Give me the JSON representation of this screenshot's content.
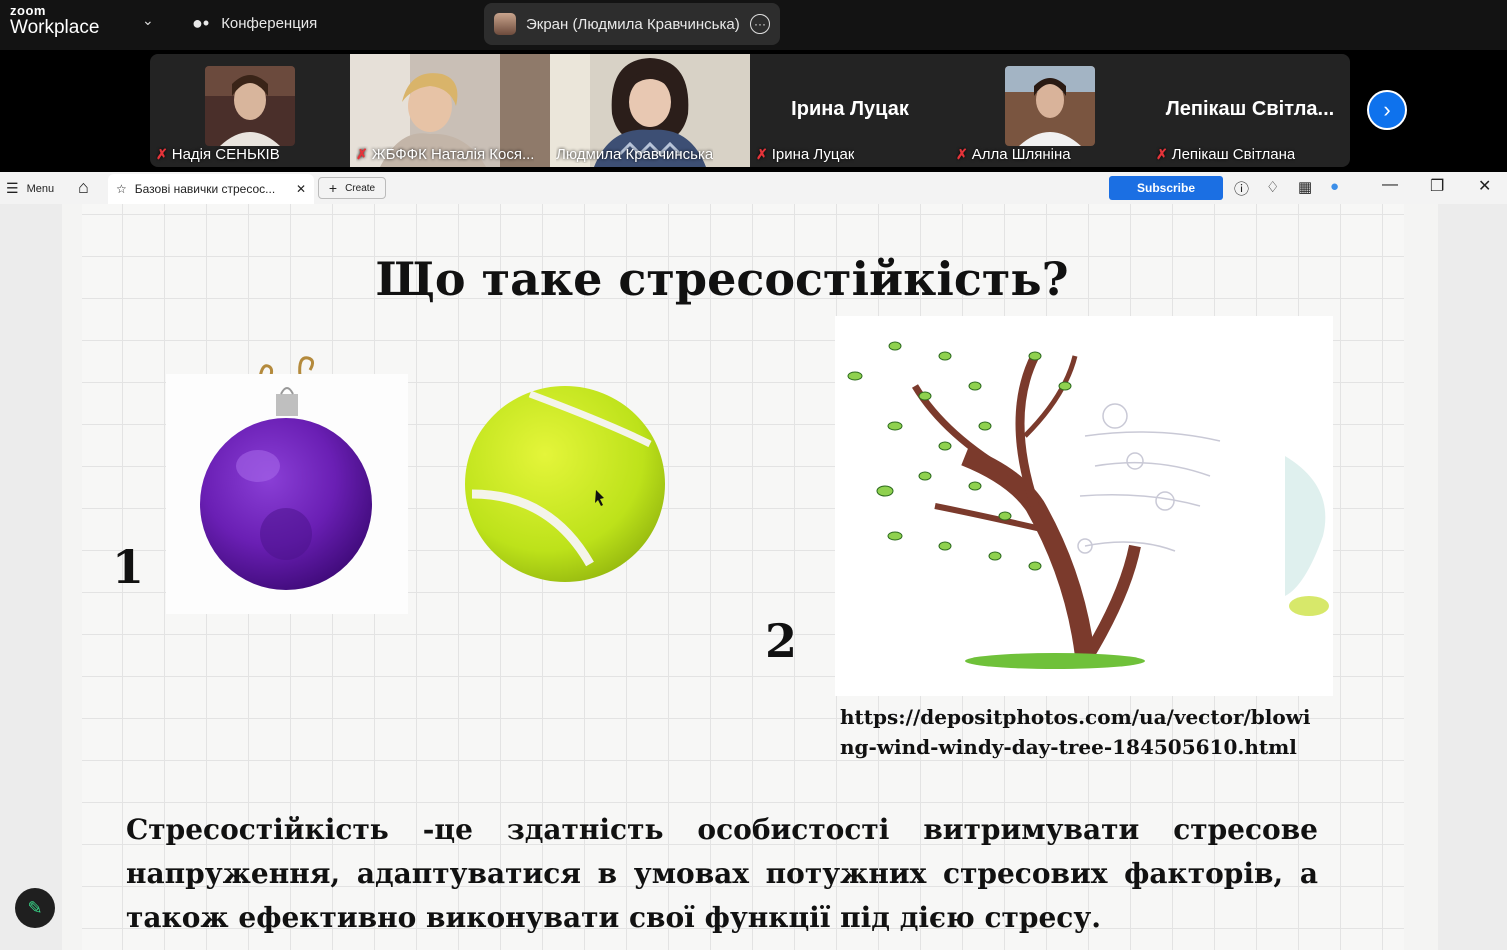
{
  "app": {
    "brand_top": "zoom",
    "brand_bottom": "Workplace",
    "meeting_label": "Конференция",
    "screen_share_label": "Экран (Людмила Кравчинська)"
  },
  "participants": [
    {
      "name": "Надія СЕНЬКІВ",
      "video": "photo"
    },
    {
      "name": "ЖБФФК Наталія Кося...",
      "video": "camera"
    },
    {
      "name": "Людмила Кравчинська",
      "video": "camera",
      "active": true
    },
    {
      "name": "Ірина Луцак",
      "display_name": "Ірина Луцак",
      "video": "off"
    },
    {
      "name": "Алла Шляніна",
      "video": "photo"
    },
    {
      "name": "Лепікаш Світлана",
      "display_name": "Лепікаш Світла...",
      "video": "off"
    }
  ],
  "browser": {
    "menu_label": "Menu",
    "tab_title": "Базові навички стресос...",
    "create_label": "Create",
    "subscribe_label": "Subscribe"
  },
  "slide": {
    "title": "Що таке стресостійкість?",
    "label_1": "1",
    "label_2": "2",
    "url_line1": "https://depositphotos.com/ua/vector/blowi",
    "url_line2": "ng-wind-windy-day-tree-184505610.html",
    "definition": "Стресостійкість -це здатність особистості витримувати стресове напруження, адаптуватися в умовах потужних стресових факторів, а також ефективно виконувати свої функції під дією стресу."
  },
  "colors": {
    "active_border": "#21c35a",
    "muted_mic": "#e5343a",
    "subscribe": "#1b6fe3",
    "next_button": "#0e72ed"
  },
  "icons": [
    "chevron-down-icon",
    "participants-icon",
    "more-icon",
    "mic-muted-icon",
    "chevron-right-icon",
    "menu-icon",
    "home-icon",
    "star-icon",
    "close-icon",
    "plus-icon",
    "help-icon",
    "bell-icon",
    "apps-icon",
    "profile-icon",
    "minimize-icon",
    "restore-icon",
    "pencil-icon"
  ]
}
